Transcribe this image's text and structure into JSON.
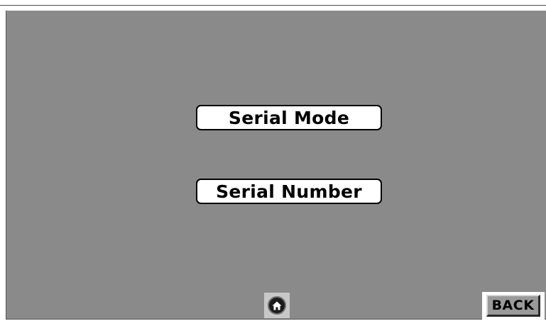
{
  "menu": {
    "serial_mode_label": "Serial Mode",
    "serial_number_label": "Serial Number"
  },
  "footer": {
    "home_icon": "home-icon",
    "back_label": "BACK"
  },
  "colors": {
    "panel_background": "#8a8a8a",
    "button_background": "#ffffff",
    "button_border": "#000000"
  }
}
